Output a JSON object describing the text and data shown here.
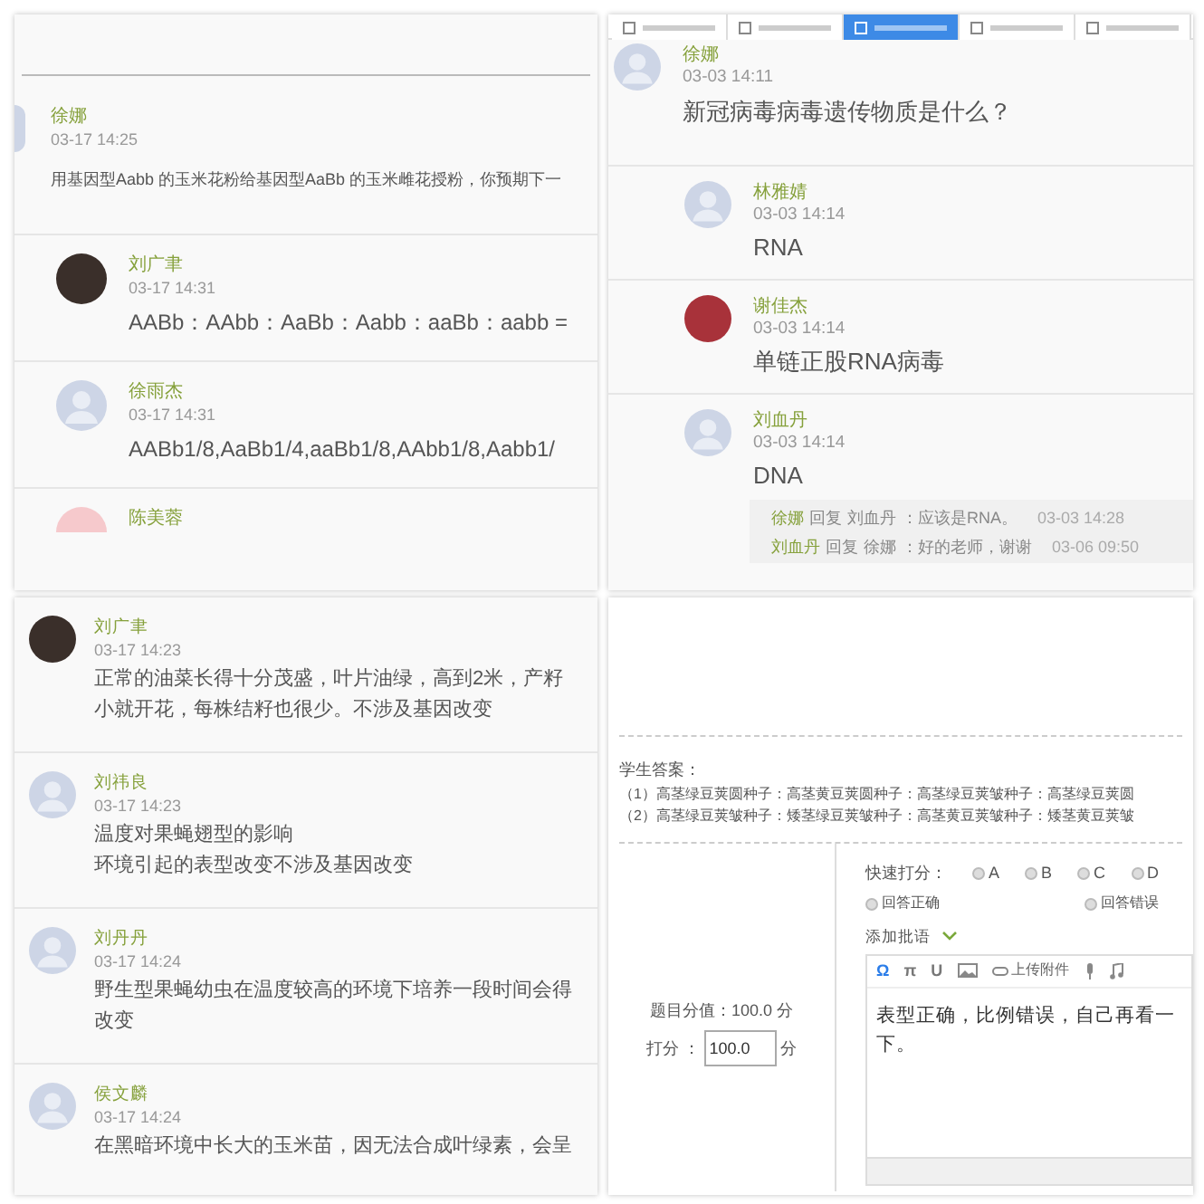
{
  "discussion_a": {
    "post": {
      "author": "徐娜",
      "time": "03-17 14:25",
      "text": "用基因型Aabb 的玉米花粉给基因型AaBb 的玉米雌花授粉，你预期下一"
    },
    "replies": [
      {
        "author": "刘广聿",
        "time": "03-17 14:31",
        "text": "AABb：AAbb：AaBb：Aabb：aaBb：aabb =",
        "kind": "photo",
        "color": "#3a2f2a"
      },
      {
        "author": "徐雨杰",
        "time": "03-17 14:31",
        "text": "AABb1/8,AaBb1/4,aaBb1/8,AAbb1/8,Aabb1/",
        "kind": "default"
      },
      {
        "author": "陈美蓉",
        "kind": "photo",
        "color": "#f6c9cc"
      }
    ]
  },
  "discussion_b": {
    "tabs": [
      {
        "selected": false
      },
      {
        "selected": false
      },
      {
        "selected": true
      },
      {
        "selected": false
      },
      {
        "selected": false
      }
    ],
    "post": {
      "author": "徐娜",
      "time": "03-03 14:11",
      "text": "新冠病毒病毒遗传物质是什么？"
    },
    "replies": [
      {
        "author": "林雅婧",
        "time": "03-03 14:14",
        "text": "RNA",
        "kind": "default"
      },
      {
        "author": "谢佳杰",
        "time": "03-03 14:14",
        "text": "单链正股RNA病毒",
        "kind": "photo",
        "color": "#a8323a"
      },
      {
        "author": "刘血丹",
        "time": "03-03 14:14",
        "text": "DNA",
        "kind": "default",
        "sub_replies": [
          {
            "author": "徐娜",
            "verb": "回复",
            "target": "刘血丹",
            "text": "：应该是RNA。",
            "time": "03-03 14:28"
          },
          {
            "author": "刘血丹",
            "verb": "回复",
            "target": "徐娜",
            "text": "：好的老师，谢谢",
            "time": "03-06 09:50"
          }
        ]
      }
    ]
  },
  "discussion_c": {
    "replies": [
      {
        "author": "刘广聿",
        "time": "03-17 14:23",
        "lines": [
          "正常的油菜长得十分茂盛，叶片油绿，高到2米，产籽",
          "小就开花，每株结籽也很少。不涉及基因改变"
        ],
        "kind": "photo",
        "color": "#3a2f2a"
      },
      {
        "author": "刘祎良",
        "time": "03-17 14:23",
        "lines": [
          "温度对果蝇翅型的影响",
          "环境引起的表型改变不涉及基因改变"
        ],
        "kind": "default"
      },
      {
        "author": "刘丹丹",
        "time": "03-17 14:24",
        "lines": [
          "野生型果蝇幼虫在温度较高的环境下培养一段时间会得",
          "改变"
        ],
        "kind": "default"
      },
      {
        "author": "侯文麟",
        "time": "03-17 14:24",
        "lines": [
          "在黑暗环境中长大的玉米苗，因无法合成叶绿素，会呈"
        ],
        "kind": "default"
      }
    ]
  },
  "grading": {
    "answer_label": "学生答案：",
    "answer_lines": [
      "（1）高茎绿豆荚圆种子：高茎黄豆荚圆种子：高茎绿豆荚皱种子：高茎绿豆荚圆",
      "（2）高茎绿豆荚皱种子：矮茎绿豆荚皱种子：高茎黄豆荚皱种子：矮茎黄豆荚皱"
    ],
    "score_value": "题目分值：100.0 分",
    "score_label": "打分 ：",
    "score": "100.0",
    "score_unit": "分",
    "quick_label": "快速打分：",
    "quick_options": [
      {
        "label": "A",
        "selected": false
      },
      {
        "label": "B",
        "selected": false
      },
      {
        "label": "C",
        "selected": false
      },
      {
        "label": "D",
        "selected": false
      }
    ],
    "verdicts": [
      {
        "label": "回答正确",
        "selected": false
      },
      {
        "label": "回答错误",
        "selected": false
      }
    ],
    "comment_label": "添加批语",
    "toolbar": [
      {
        "kind": "glyph",
        "label": "Ω",
        "selected": true
      },
      {
        "kind": "glyph",
        "label": "π",
        "selected": false
      },
      {
        "kind": "glyph",
        "label": "U",
        "selected": false
      },
      {
        "kind": "image"
      },
      {
        "kind": "attach",
        "label": "上传附件"
      },
      {
        "kind": "mic"
      },
      {
        "kind": "music"
      }
    ],
    "comment": "表型正确，比例错误，自己再看一下。"
  }
}
